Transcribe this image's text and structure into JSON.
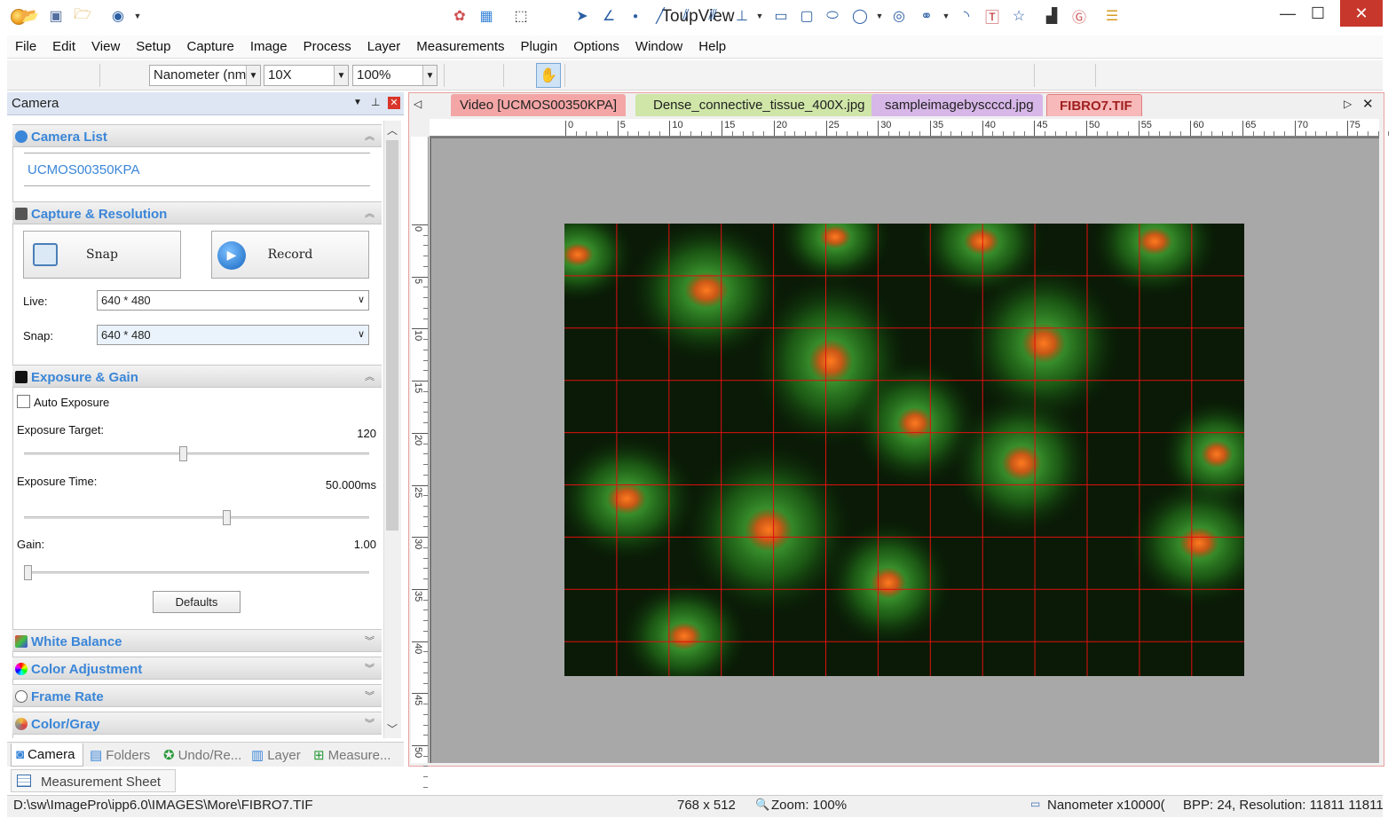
{
  "window": {
    "title": "ToupView",
    "minimize": "—",
    "maximize": "☐",
    "close": "✕"
  },
  "menu": [
    "File",
    "Edit",
    "View",
    "Setup",
    "Capture",
    "Image",
    "Process",
    "Layer",
    "Measurements",
    "Plugin",
    "Options",
    "Window",
    "Help"
  ],
  "toolbar": {
    "unit": "Nanometer (nm",
    "magnification": "10X",
    "zoom": "100%"
  },
  "panel": {
    "title": "Camera",
    "sections": {
      "camera_list": "Camera List",
      "capture": "Capture & Resolution",
      "exposure": "Exposure & Gain",
      "white_balance": "White Balance",
      "color_adjustment": "Color Adjustment",
      "frame_rate": "Frame Rate",
      "color_gray": "Color/Gray"
    },
    "camera_name": "UCMOS00350KPA",
    "snap_label": "Snap",
    "record_label": "Record",
    "live_label": "Live:",
    "live_value": "640 * 480",
    "snap_res_label": "Snap:",
    "snap_res_value": "640 * 480",
    "auto_exposure": "Auto Exposure",
    "exposure_target_label": "Exposure Target:",
    "exposure_target_value": "120",
    "exposure_target_level": 0.46,
    "exposure_time_label": "Exposure Time:",
    "exposure_time_value": "50.000ms",
    "exposure_time_level": 0.59,
    "gain_label": "Gain:",
    "gain_value": "1.00",
    "gain_level": 0.0,
    "defaults_label": "Defaults"
  },
  "bottom_tabs": [
    "Camera",
    "Folders",
    "Undo/Re...",
    "Layer",
    "Measure..."
  ],
  "measurement_sheet": "Measurement Sheet",
  "doc_tabs": [
    {
      "label": "Video [UCMOS00350KPA]",
      "color": "#f4a6a6"
    },
    {
      "label": "Dense_connective_tissue_400X.jpg",
      "color": "#cfe6a8"
    },
    {
      "label": "sampleimagebyscccd.jpg",
      "color": "#d7b6e8"
    },
    {
      "label": "FIBRO7.TIF",
      "color": "#f7b9b9"
    }
  ],
  "ruler_h": [
    "0",
    "5",
    "10",
    "15",
    "20",
    "25",
    "30",
    "35",
    "40",
    "45",
    "50",
    "55",
    "60",
    "65",
    "70",
    "75"
  ],
  "ruler_v": [
    "0",
    "5",
    "10",
    "15",
    "20",
    "25",
    "30",
    "35",
    "40",
    "45",
    "50"
  ],
  "status": {
    "path": "D:\\sw\\ImagePro\\ipp6.0\\IMAGES\\More\\FIBRO7.TIF",
    "dimensions": "768 x 512",
    "zoom": "Zoom: 100%",
    "unit": "Nanometer x10000(",
    "bpp": "BPP: 24, Resolution: 11811 11811"
  },
  "colors": {
    "accent": "#3a86d8",
    "grid": "#e01010",
    "close": "#c7372c"
  }
}
